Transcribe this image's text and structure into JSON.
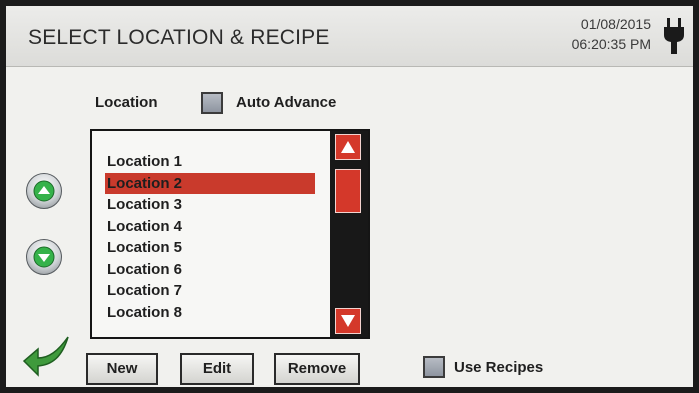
{
  "header": {
    "title": "SELECT LOCATION & RECIPE",
    "date": "01/08/2015",
    "time": "06:20:35 PM",
    "power_icon": "plug-icon"
  },
  "location": {
    "label": "Location",
    "auto_advance_label": "Auto Advance",
    "auto_advance_checked": false
  },
  "list": {
    "items": [
      "Location 1",
      "Location 2",
      "Location 3",
      "Location 4",
      "Location 5",
      "Location 6",
      "Location 7",
      "Location 8"
    ],
    "selected_index": 1
  },
  "actions": {
    "new_label": "New",
    "edit_label": "Edit",
    "remove_label": "Remove"
  },
  "recipes": {
    "use_recipes_label": "Use Recipes",
    "use_recipes_checked": false
  },
  "colors": {
    "selection": "#c93a2c",
    "scroll_accent": "#d4382a",
    "back_arrow": "#3f9a3c"
  }
}
